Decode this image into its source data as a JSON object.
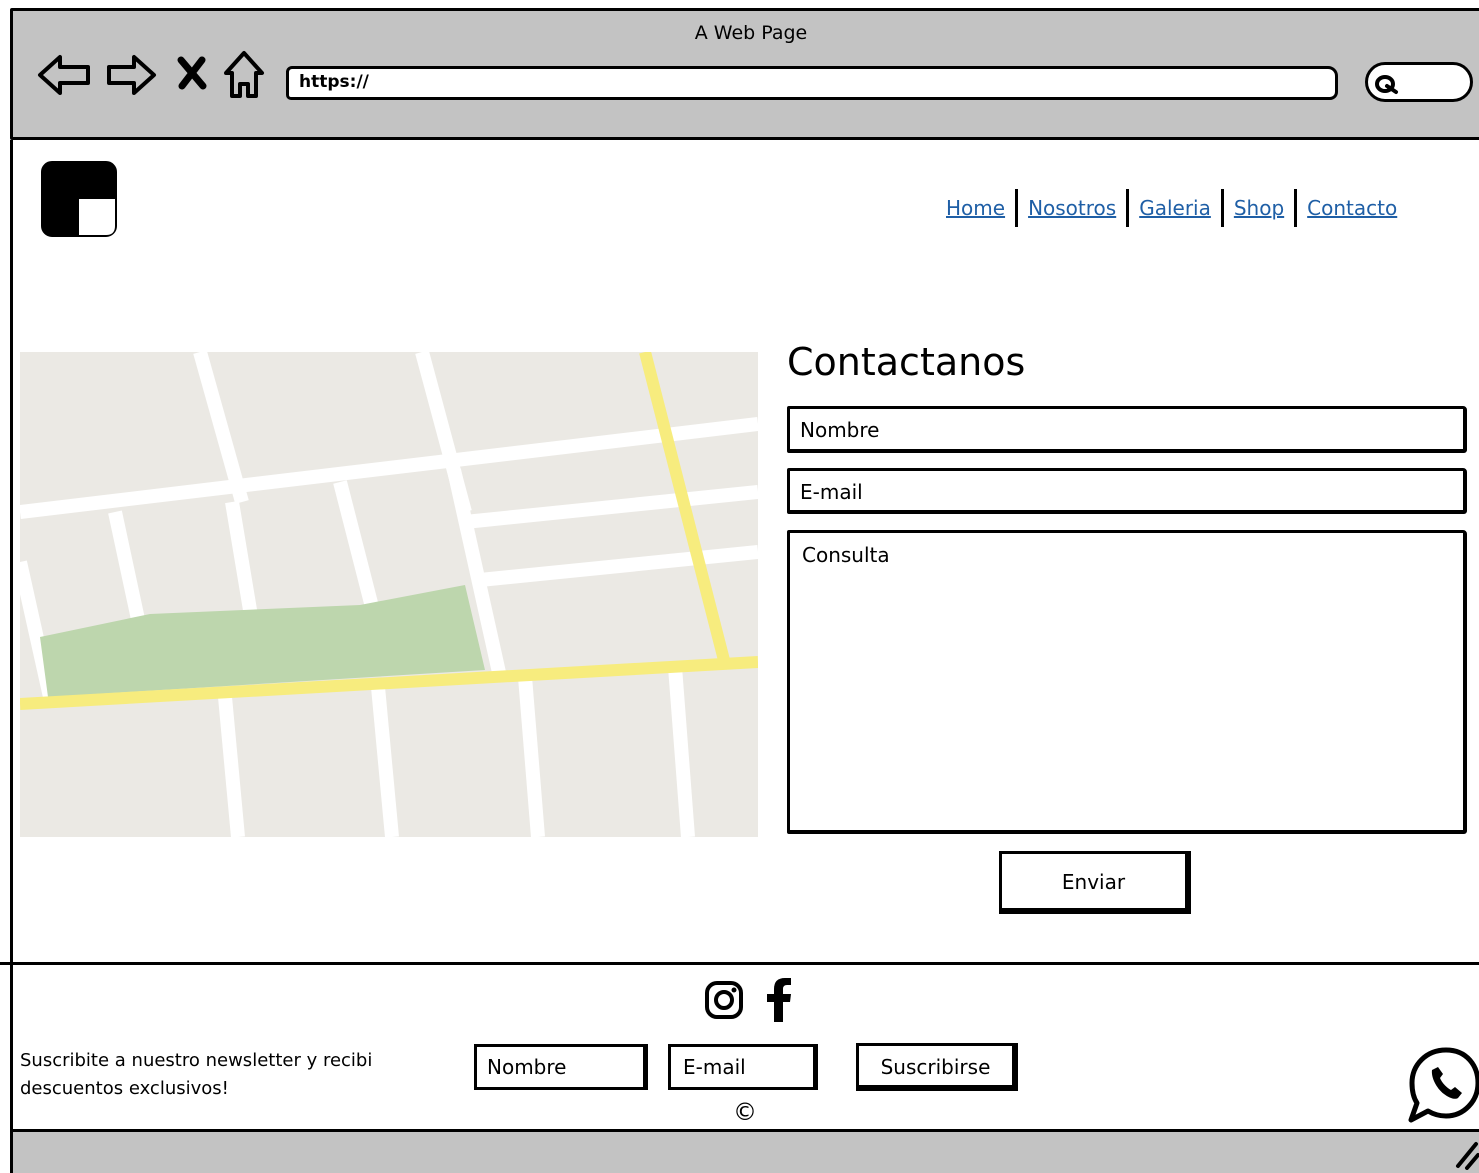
{
  "window": {
    "title": "A Web Page"
  },
  "browser": {
    "url": "https://",
    "icons": [
      "back-arrow-icon",
      "forward-arrow-icon",
      "close-icon",
      "home-icon",
      "search-icon"
    ]
  },
  "nav": {
    "links": [
      "Home",
      "Nosotros",
      "Galeria",
      "Shop",
      "Contacto"
    ]
  },
  "contact": {
    "title": "Contactanos",
    "name_placeholder": "Nombre",
    "email_placeholder": "E-mail",
    "message_placeholder": "Consulta",
    "submit_label": "Enviar"
  },
  "footer": {
    "newsletter_text": "Suscribite a nuestro newsletter y recibi descuentos exclusivos!",
    "name_placeholder": "Nombre",
    "email_placeholder": "E-mail",
    "subscribe_label": "Suscribirse",
    "copyright": "©",
    "social_icons": [
      "instagram-icon",
      "facebook-icon"
    ],
    "chat_icon": "whatsapp-icon"
  },
  "colors": {
    "chrome": "#c3c3c3",
    "link": "#1f5fa6",
    "map_ground": "#ebe9e4",
    "map_road": "#f7ec7e",
    "map_park": "#bdd6ad"
  }
}
